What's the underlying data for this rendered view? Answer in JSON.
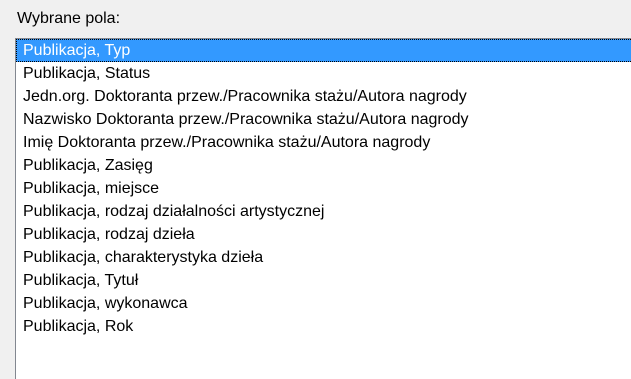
{
  "field_label": "Wybrane pola:",
  "colors": {
    "selection": "#3399ff",
    "window_background": "#f0f0f0",
    "list_border": "#828790"
  },
  "list": {
    "selected_index": 0,
    "items": [
      "Publikacja, Typ",
      "Publikacja, Status",
      "Jedn.org. Doktoranta przew./Pracownika stażu/Autora nagrody",
      "Nazwisko Doktoranta przew./Pracownika stażu/Autora nagrody",
      "Imię Doktoranta przew./Pracownika stażu/Autora nagrody",
      "Publikacja, Zasięg",
      "Publikacja, miejsce",
      "Publikacja, rodzaj działalności artystycznej",
      "Publikacja, rodzaj dzieła",
      "Publikacja, charakterystyka dzieła",
      "Publikacja, Tytuł",
      "Publikacja, wykonawca",
      "Publikacja, Rok"
    ]
  }
}
